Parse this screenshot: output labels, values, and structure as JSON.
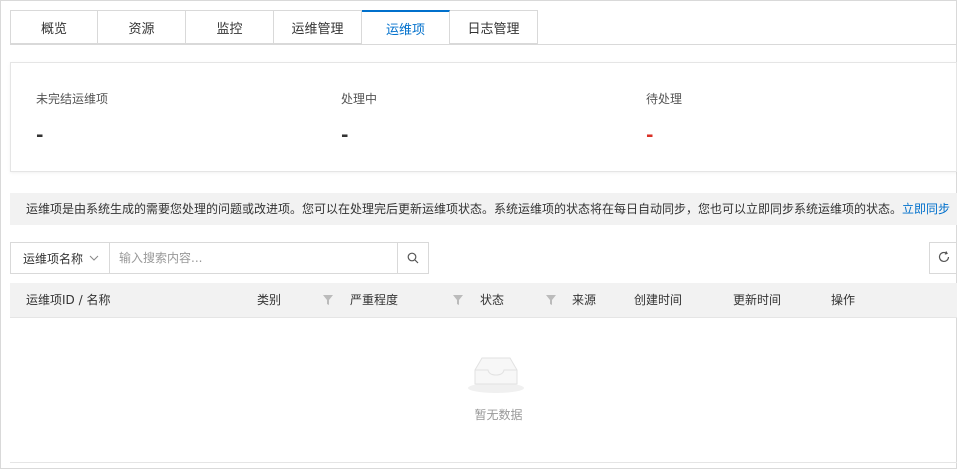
{
  "tabs": [
    {
      "label": "概览",
      "active": false
    },
    {
      "label": "资源",
      "active": false
    },
    {
      "label": "监控",
      "active": false
    },
    {
      "label": "运维管理",
      "active": false
    },
    {
      "label": "运维项",
      "active": true
    },
    {
      "label": "日志管理",
      "active": false
    }
  ],
  "stats": [
    {
      "label": "未完结运维项",
      "value": "-"
    },
    {
      "label": "处理中",
      "value": "-"
    },
    {
      "label": "待处理",
      "value": "-",
      "value_color": "#d93026"
    }
  ],
  "notice": {
    "text": "运维项是由系统生成的需要您处理的问题或改进项。您可以在处理完后更新运维项状态。系统运维项的状态将在每日自动同步，您也可以立即同步系统运维项的状态。",
    "link": "立即同步"
  },
  "search": {
    "select_value": "运维项名称",
    "placeholder": "输入搜索内容...",
    "search_icon": "search-icon",
    "refresh_icon": "refresh-icon"
  },
  "table": {
    "columns": [
      "运维项ID / 名称",
      "类别",
      "严重程度",
      "状态",
      "来源",
      "创建时间",
      "更新时间",
      "操作"
    ],
    "empty_text": "暂无数据"
  },
  "colors": {
    "accent": "#0070cc",
    "danger": "#d93026"
  }
}
